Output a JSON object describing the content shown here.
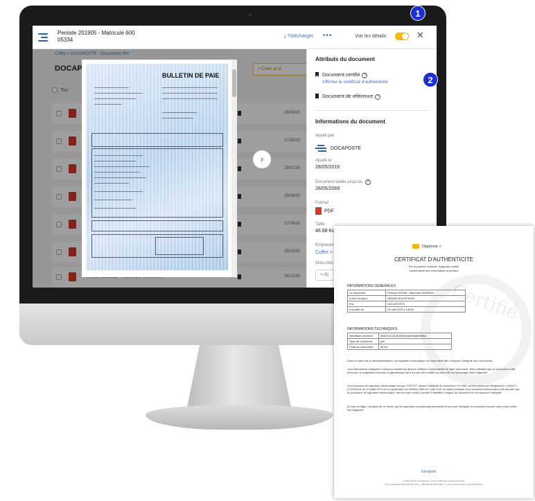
{
  "header": {
    "title_line1": "Periode 201905 - Matricule 600",
    "title_line2": "05334",
    "download_label": "Télécharger",
    "more_label": "•••",
    "details_label": "Voir les détails",
    "details_toggle": "on",
    "close_label": "✕"
  },
  "list": {
    "breadcrumb": "Coffre > DOCAPOSTE - Documents RH",
    "title": "DOCAP",
    "create_label": "+ Créer un d",
    "select_all_label": "Tou",
    "rows": [
      {
        "date": "28/05/20"
      },
      {
        "date": "27/06/20"
      },
      {
        "date": "29/07/20"
      },
      {
        "date": "29/08/20"
      },
      {
        "date": "27/09/20"
      },
      {
        "date": "29/10/20"
      },
      {
        "name": "Periode 201911 - Matricule 60005334",
        "date": "28/11/20"
      }
    ]
  },
  "preview": {
    "doc_title": "BULLETIN DE PAIE",
    "next_label": "›"
  },
  "panel": {
    "attributes_title": "Attributs du document",
    "certified_label": "Document certifié",
    "certificate_link": "Afficher le certificat d'authenticité",
    "reference_label": "Document de référence",
    "help_glyph": "?",
    "info_title": "Informations du document",
    "added_by_label": "Ajouté par",
    "added_by_value": "DOCAPOSTE",
    "added_on_label": "Ajouté le",
    "added_on_value": "28/05/2019",
    "valid_until_label": "Document valide jusqu'au",
    "valid_until_value": "28/05/2069",
    "format_label": "Format",
    "format_value": "PDF",
    "size_label": "Taille",
    "size_value": "46.68 Ko",
    "location_label": "Emplacen",
    "location_value": "Coffre >",
    "keywords_label": "Mots-clés",
    "add_keyword_label": "+ Aj"
  },
  "badges": {
    "one": "1",
    "two": "2"
  },
  "certificate": {
    "logo_text": "Digiposte +",
    "title": "CERTIFICAT D'AUTHENTICITE",
    "subtitle_line1": "Par le présent certificat, Digiposte certifie",
    "subtitle_line2": "l'authenticité des informations suivantes",
    "watermark": "Certifié",
    "general_title": "INFORMATIONS GENERALES",
    "general_rows": [
      [
        "Le document",
        "Periode 201905 - Matricule 60005334"
      ],
      [
        "A été envoyé à",
        "SEBASTIEN ROSAYE"
      ],
      [
        "Par",
        "DOCAPOSTE"
      ],
      [
        "A la date du",
        "28 mai 2019 à 14h16"
      ]
    ],
    "technical_title": "INFORMATIONS TECHNIQUES",
    "technical_rows": [
      [
        "Identifiant d'archive",
        "5bf4f7d142c3b0f2b09bee9ad0288fcd"
      ],
      [
        "Type de document",
        "pdf"
      ],
      [
        "Poids du document",
        "46 Ko"
      ]
    ],
    "para1": "Dans le cadre de la dématérialisation, la traçabilité informatique est essentielle afin d'assurer l'intégrité des documents.",
    "para2": "Les informations indiquées ci-dessus constituent ainsi le certificat d'authenticité de votre document. Elles attestent que le document a été émis par un organisme reconnu et garantissent qu'il n'a pas été modifié au cours de son archivage dans Digiposte.",
    "para3": "Un processus de signature électronique de type \"PKCS7\" assure l'intégrité du document. En effet, conformément au Règlement « eIDAS » n°910/2014 du 23 juillet 2014 et en application de l'article 1366 du Code Civil, la valeur juridique d'un document électronique est assurée par le processus de signature électronique, dès lors que celle-ci permet d'identifier l'origine du document et d'en assurer l'intégrité.",
    "para4": "En cas de litige, l'analyse de ce fichier par les autorités compétentes permettra de prouver l'intégrité du document stocké dans votre coffre-fort Digiposte.",
    "footer_logo": "Docapost",
    "footer_line1": "Certificat émis par Digiposte, service édité par le Groupe La Poste",
    "footer_line2": "SA au capital de 3 800 000 000 euros - 356 000 000 RCS Paris - 9 rue du Colonel Pierre Avia 75015 Paris"
  }
}
